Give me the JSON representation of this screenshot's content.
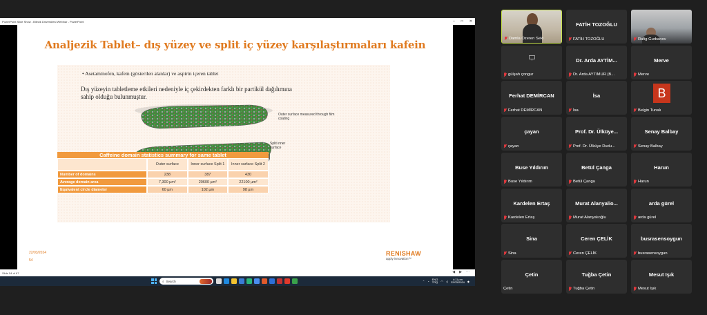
{
  "window_title": "PowerPoint Slide Show  -  Bilecik Üniversitesi Webinar - PowerPoint",
  "slide": {
    "title": "Analjezik Tablet– dış yüzey ve split iç yüzey karşılaştırmaları kafein",
    "bullet": "•  Asetaminofen, kafein (gösterilen alanlar) ve aspirin içeren tablet",
    "paragraph": "Dış yüzeyin tabletleme etkileri nedeniyle iç çekirdekten farklı bir partikül dağılımına sahip olduğu bulunmuştur.",
    "caption_outer": "Outer surface measured through film coating",
    "caption_inner": "Split inner surface",
    "table": {
      "title": "Caffeine domain statistics summary for same tablet",
      "columns": [
        "Outer surface",
        "Inner surface Split 1",
        "Inner surface Split 2"
      ],
      "rows": [
        {
          "label": "Number of domains",
          "values": [
            "238",
            "387",
            "430"
          ]
        },
        {
          "label": "Average domain area",
          "values": [
            "7,300 µm²",
            "20600 µm²",
            "22100 µm²"
          ]
        },
        {
          "label": "Equivalent circle diameter",
          "values": [
            "60 µm",
            "102 µm",
            "98 µm"
          ]
        }
      ]
    },
    "date": "22/03/2024",
    "number": "54",
    "logo_name": "RENISHAW",
    "logo_tagline": "apply innovation™"
  },
  "slide_status": "Slide 54 of 67",
  "taskbar": {
    "search_placeholder": "Search",
    "lang": "ENG",
    "lang2": "TRQ",
    "time": "4:11 pm",
    "date": "22/03/2024"
  },
  "participants": [
    {
      "id": "damla",
      "display": "",
      "label": "Damla Ozeren Seki",
      "video": true
    },
    {
      "id": "fatih",
      "display": "FATİH TOZOĞLU",
      "label": "FATİH TOZOĞLU"
    },
    {
      "id": "rafig",
      "display": "",
      "label": "Rafig Gurbanov",
      "video": true
    },
    {
      "id": "gulsah",
      "display": "",
      "label": "gülşah çongur",
      "icon": true
    },
    {
      "id": "arda",
      "display": "Dr. Arda AYTİM...",
      "label": "Dr. Arda AYTİMUR (B..."
    },
    {
      "id": "merve",
      "display": "Merve",
      "label": "Merve"
    },
    {
      "id": "ferhat",
      "display": "Ferhat DEMİRCAN",
      "label": "Ferhat DEMİRCAN"
    },
    {
      "id": "isa",
      "display": "İsa",
      "label": "İsa"
    },
    {
      "id": "belgin",
      "display": "",
      "label": "Belgin Tunalı",
      "avatar": "B"
    },
    {
      "id": "cayan",
      "display": "çayan",
      "label": "çayan"
    },
    {
      "id": "ulkuye",
      "display": "Prof. Dr. Ülküye...",
      "label": "Prof. Dr. Ülküye Dudu..."
    },
    {
      "id": "senay",
      "display": "Senay Balbay",
      "label": "Senay Balbay"
    },
    {
      "id": "buse",
      "display": "Buse Yıldırım",
      "label": "Buse Yıldırım"
    },
    {
      "id": "betul",
      "display": "Betül Çanga",
      "label": "Betül Çanga"
    },
    {
      "id": "harun",
      "display": "Harun",
      "label": "Harun"
    },
    {
      "id": "kardelen",
      "display": "Kardelen Ertaş",
      "label": "Kardelen Ertaş"
    },
    {
      "id": "murat",
      "display": "Murat  Alanyalio...",
      "label": "Murat Alanyalıoğlu"
    },
    {
      "id": "ardagurel",
      "display": "arda gürel",
      "label": "arda gürel"
    },
    {
      "id": "sina",
      "display": "Sina",
      "label": "Sina"
    },
    {
      "id": "ceren",
      "display": "Ceren ÇELİK",
      "label": "Ceren ÇELİK"
    },
    {
      "id": "busrasen",
      "display": "busrasensoygun",
      "label": "busrasensoygun"
    },
    {
      "id": "cetin",
      "display": "Çetin",
      "label": "Çetin",
      "nomute": true
    },
    {
      "id": "tugba",
      "display": "Tuğba Çetin",
      "label": "Tuğba Çetin"
    },
    {
      "id": "mesut",
      "display": "Mesut Işık",
      "label": "Mesut Işık"
    }
  ],
  "colors": {
    "accent": "#e07a1f",
    "table_header": "#f19a3e",
    "mute": "#e0393e",
    "active_speaker": "#c7e24a"
  }
}
